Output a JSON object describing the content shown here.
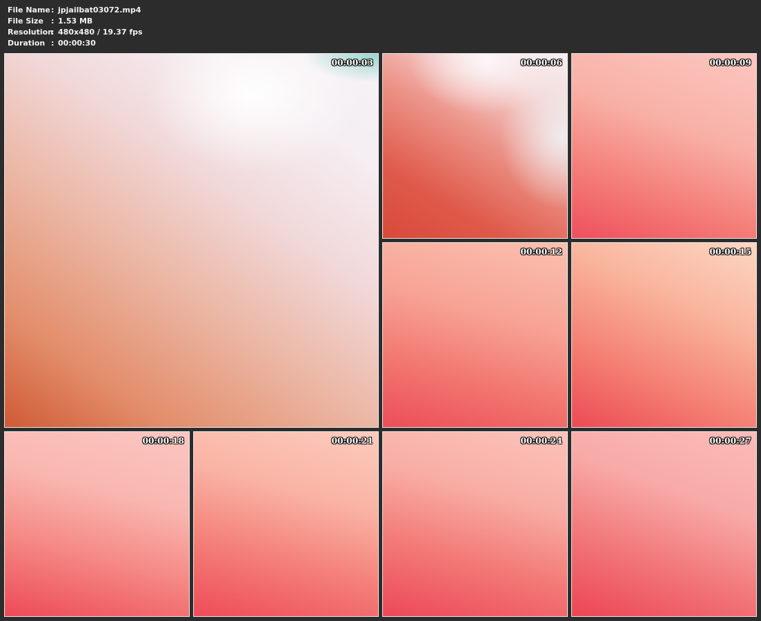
{
  "info": {
    "file_name": {
      "label": "File Name",
      "sep": ":",
      "value": "jpjailbat03072.mp4"
    },
    "file_size": {
      "label": "File Size",
      "sep": ":",
      "value": "1.53 MB"
    },
    "resolution": {
      "label": "Resolution",
      "sep": ":",
      "value": "480x480 / 19.37 fps"
    },
    "duration": {
      "label": "Duration",
      "sep": ":",
      "value": "00:00:30"
    }
  },
  "frames": [
    {
      "timestamp": "00:00:03"
    },
    {
      "timestamp": "00:00:06"
    },
    {
      "timestamp": "00:00:09"
    },
    {
      "timestamp": "00:00:12"
    },
    {
      "timestamp": "00:00:15"
    },
    {
      "timestamp": "00:00:18"
    },
    {
      "timestamp": "00:00:21"
    },
    {
      "timestamp": "00:00:24"
    },
    {
      "timestamp": "00:00:27"
    }
  ],
  "colors": {
    "background": "#2c2c2c",
    "info_text": "#f2f2f2",
    "tile_border": "#e8e8e8"
  }
}
